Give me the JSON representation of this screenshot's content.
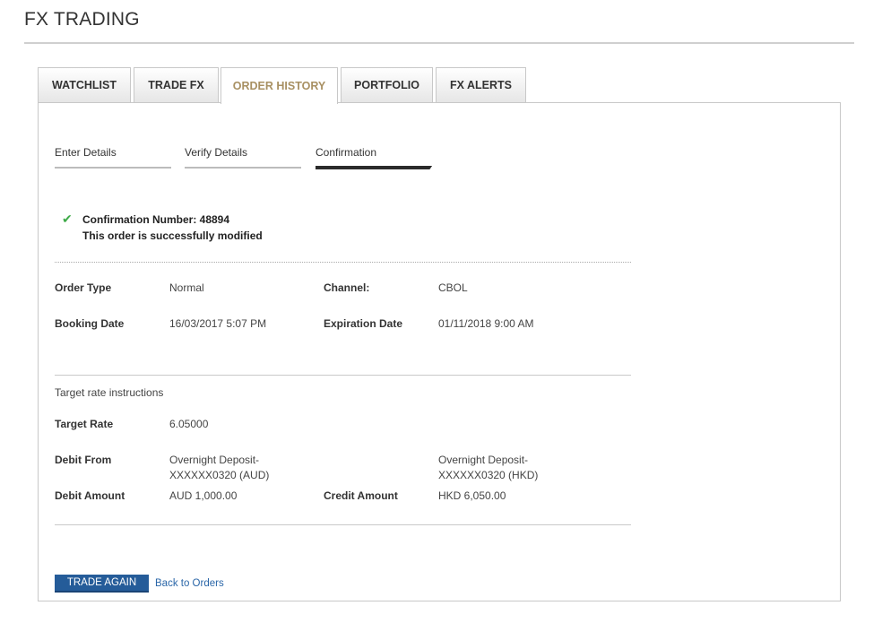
{
  "header": {
    "title": "FX TRADING"
  },
  "tabs": [
    {
      "label": "WATCHLIST"
    },
    {
      "label": "TRADE FX"
    },
    {
      "label": "ORDER HISTORY"
    },
    {
      "label": "PORTFOLIO"
    },
    {
      "label": "FX ALERTS"
    }
  ],
  "steps": [
    {
      "label": "Enter Details"
    },
    {
      "label": "Verify Details"
    },
    {
      "label": "Confirmation"
    }
  ],
  "confirmation": {
    "number_line": "Confirmation Number: 48894",
    "message": "This order is successfully modified"
  },
  "details": {
    "order_type_label": "Order Type",
    "order_type_value": "Normal",
    "channel_label": "Channel:",
    "channel_value": "CBOL",
    "booking_date_label": "Booking Date",
    "booking_date_value": "16/03/2017 5:07 PM",
    "expiration_date_label": "Expiration Date",
    "expiration_date_value": "01/11/2018 9:00 AM"
  },
  "target": {
    "section_title": "Target rate instructions",
    "rate_label": "Target Rate",
    "rate_value": "6.05000",
    "debit_from_label": "Debit From",
    "debit_from_value_1": "Overnight Deposit-",
    "debit_from_value_2": "XXXXXX0320 (AUD)",
    "credit_to_value_1": "Overnight Deposit-",
    "credit_to_value_2": "XXXXXX0320 (HKD)",
    "debit_amount_label": "Debit Amount",
    "debit_amount_value": "AUD 1,000.00",
    "credit_amount_label": "Credit Amount",
    "credit_amount_value": "HKD 6,050.00"
  },
  "actions": {
    "trade_again": "TRADE AGAIN",
    "back_link": "Back to Orders"
  },
  "colors": {
    "active_tab_text": "#a89062",
    "check_green": "#3eaa48",
    "primary_button": "#255c99",
    "link": "#2a66a8"
  }
}
